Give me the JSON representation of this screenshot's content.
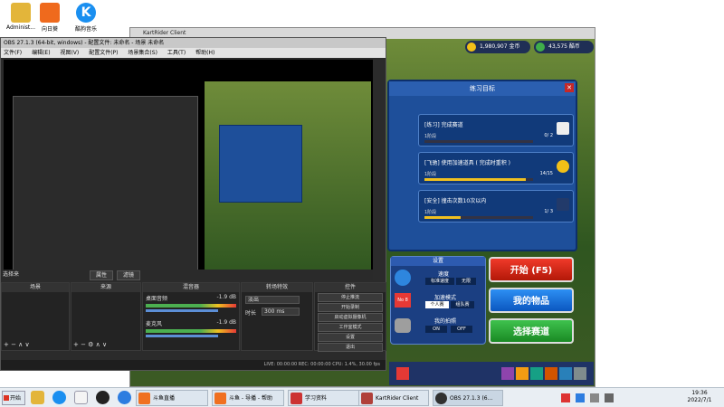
{
  "desktop": {
    "icons": [
      {
        "label": "Administ...",
        "color": "#e3b53a"
      },
      {
        "label": "向日葵",
        "color": "#ef6a1d"
      },
      {
        "label": "酷狗音乐",
        "color": "#1a8ff0"
      }
    ]
  },
  "game": {
    "title": "KartRider Client",
    "coins": "1,980,907 金币",
    "lucci": "43,575 酷币",
    "practice_title": "练习目标",
    "goals": [
      {
        "title": "[练习] 完成赛道",
        "desc": "1阶段",
        "count": "0/ 2",
        "progress": 0.0
      },
      {
        "title": "[飞驰] 使用加速道具 ( 完成时重积 )",
        "desc": "1阶段",
        "count": "14/15",
        "progress": 0.93
      },
      {
        "title": "[安全] 撞击次数10次以内",
        "desc": "1阶段",
        "count": "1/ 3",
        "progress": 0.33
      }
    ],
    "settings": {
      "title": "设置",
      "speed_label": "速度",
      "speed_opts": [
        "标准速度",
        "无限"
      ],
      "mode_label": "加速模式",
      "mode_opts": [
        "个人赛",
        "组队赛"
      ],
      "intro_label": "我的拍照",
      "intro_opts": [
        "ON",
        "OFF"
      ],
      "badge": "No 8"
    },
    "buttons": {
      "start": "开始 (F5)",
      "items": "我的物品",
      "track": "选择赛道"
    }
  },
  "obs": {
    "title": "OBS 27.1.3 (64-bit, windows) - 配置文件: 未命名 - 场景  未命名",
    "menu": [
      "文件(F)",
      "编辑(E)",
      "视图(V)",
      "配置文件(P)",
      "场景集合(S)",
      "工具(T)",
      "帮助(H)"
    ],
    "source_header": "选择来",
    "props_btn": "属性",
    "filter_btn": "滤镜",
    "docks": {
      "scenes": "场景",
      "sources": "来源",
      "mixer": "混音器",
      "transitions": "转场特效",
      "controls": "控件"
    },
    "mixer": [
      {
        "name": "桌面音频",
        "db": "-1.9 dB"
      },
      {
        "name": "麦克风",
        "db": "-1.9 dB"
      }
    ],
    "transition": {
      "type": "淡出",
      "duration_label": "时长",
      "duration": "300 ms"
    },
    "controls": [
      "停止推流",
      "开始录制",
      "启动虚拟摄像机",
      "工作室模式",
      "设置",
      "退出"
    ],
    "status": "LIVE: 00:00:00   REC: 00:00:00   CPU: 1.4%, 30.00 fps"
  },
  "taskbar": {
    "start": "开始",
    "items": [
      {
        "label": "斗鱼直播",
        "color": "#f07020"
      },
      {
        "label": "斗鱼 - 导播 - 帮助",
        "color": "#f07020"
      },
      {
        "label": "学习资料",
        "color": "#cc3333"
      },
      {
        "label": "KartRider Client",
        "color": "#b0403a"
      },
      {
        "label": "OBS 27.1.3 (6...",
        "color": "#303030"
      }
    ],
    "time": "19:36",
    "date": "2022/7/1"
  }
}
